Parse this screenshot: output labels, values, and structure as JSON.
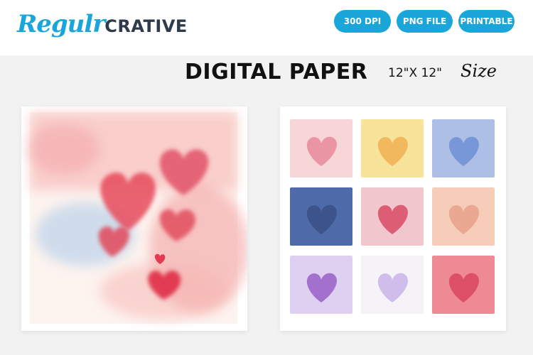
{
  "brand": {
    "script_part": "Regulr",
    "block_part": "CRATIVE",
    "accent_color": "#1aa6d8",
    "block_color": "#2f3a4a"
  },
  "badges": [
    {
      "label": "300 DPI"
    },
    {
      "label": "PNG FILE"
    },
    {
      "label": "PRINTABLE"
    }
  ],
  "heading": {
    "title": "DIGITAL PAPER",
    "dimensions": "12\"X 12\"",
    "size_word": "Size"
  },
  "preview_left": {
    "icon": "watercolor-hearts-paper",
    "heart_color": "#e0485a",
    "wash_colors": [
      "#f4a3a8",
      "#bcd3ea",
      "#fbe3df"
    ]
  },
  "preview_right": {
    "icon": "heart-tile-grid",
    "tiles": [
      {
        "bg": "#f7d6d8",
        "heart": "#e88a9a"
      },
      {
        "bg": "#f7e39a",
        "heart": "#f0b054"
      },
      {
        "bg": "#aebfe6",
        "heart": "#6f8fd6"
      },
      {
        "bg": "#4f6aa8",
        "heart": "#3a4f86"
      },
      {
        "bg": "#f2c6cd",
        "heart": "#d94a64"
      },
      {
        "bg": "#f5cdb8",
        "heart": "#e8a08a"
      },
      {
        "bg": "#ddd0f0",
        "heart": "#9a5fc8"
      },
      {
        "bg": "#f6f3f8",
        "heart": "#c9b3ea"
      },
      {
        "bg": "#ee8a94",
        "heart": "#d94560"
      }
    ]
  }
}
